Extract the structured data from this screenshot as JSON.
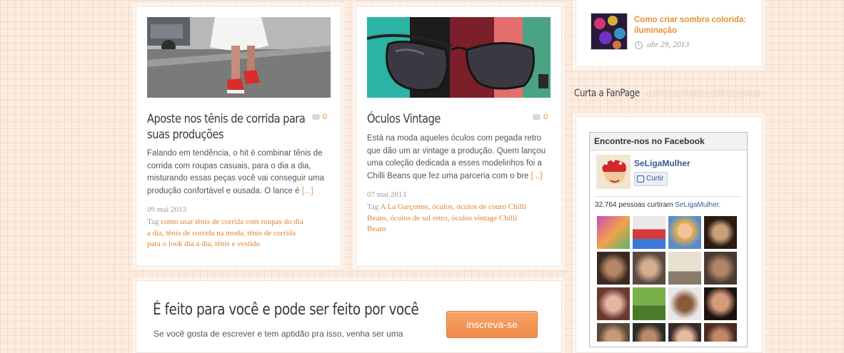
{
  "posts": [
    {
      "title_line1": "Aposte nos tênis de corrida para",
      "title_line2": "suas produções",
      "comments": "0",
      "excerpt_lines": [
        "Falando em tendência, o hit é combinar tênis de",
        "corrida com roupas casuais, para o dia a dia,",
        "misturando essas peças você vai conseguir uma",
        "produção confortável e ousada. O lance é"
      ],
      "readmore": "[...]",
      "date": "09 mai 2013",
      "tag_prefix": "Tag",
      "tags_lines": [
        "como usar tênis de corrida com roupas do dia",
        "a dia, tênis de corrida na moda, tênis de corrida",
        "para o look dia a dia, tênis e vestido"
      ],
      "image_icon": "running-shoes-photo"
    },
    {
      "title_line1": "Óculos Vintage",
      "comments": "0",
      "excerpt_lines": [
        "Está na moda aqueles óculos com pegada retro",
        "que dão um ar vintage a produção. Quem lançou",
        "uma coleção dedicada a esses modelinhos foi a",
        "Chilli Beans que fez uma parceria com o bre"
      ],
      "readmore": "[...]",
      "date": "07 mai 2013",
      "tag_prefix": "Tag",
      "tags_lines": [
        "A La Garçonne, óculos, óculos de couro Chilli",
        "Beans, óculos de sal retro, óculos vintage Chilli",
        "Beans"
      ],
      "image_icon": "sunglasses-photo"
    }
  ],
  "sidebar": {
    "recent": {
      "title_line1": "Como criar sombra colorida:",
      "title_line2": "iluminação",
      "date": "abr 29, 2013"
    },
    "fanpage_heading": "Curta a FanPage",
    "facebook": {
      "header": "Encontre-nos no Facebook",
      "page_name": "SeLigaMulher",
      "like_label": "Curtir",
      "count_text": "32.764 pessoas curtiram",
      "count_link": "SeLigaMulher",
      "count_suffix": "."
    }
  },
  "cta": {
    "title": "É feito para você e pode ser feito por você",
    "text": "Se você gosta de escrever e tem aptidão pra isso, venha ser uma",
    "button": "inscreva-se"
  },
  "colors": {
    "accent": "#e8913a",
    "facebook_blue": "#3b5998",
    "button_orange": "#ef8a48"
  }
}
